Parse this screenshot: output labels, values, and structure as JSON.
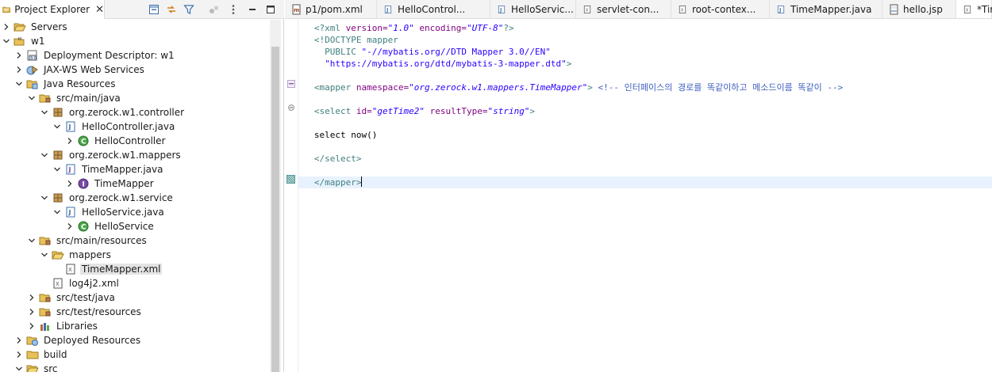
{
  "explorer": {
    "tab_title": "Project Explorer",
    "close_glyph": "✕",
    "toolbar_icons": [
      "collapse-all-icon",
      "link-with-editor-icon",
      "filter-icon",
      "focus-icon",
      "view-menu-icon",
      "minimize-icon",
      "maximize-icon"
    ],
    "tree": [
      {
        "label": "Servers",
        "icon": "folder-open-icon",
        "depth": 0,
        "twisty": "collapsed"
      },
      {
        "label": "w1",
        "icon": "web-project-icon",
        "depth": 0,
        "twisty": "expanded"
      },
      {
        "label": "Deployment Descriptor: w1",
        "icon": "deployment-descriptor-icon",
        "depth": 1,
        "twisty": "collapsed"
      },
      {
        "label": "JAX-WS Web Services",
        "icon": "web-services-icon",
        "depth": 1,
        "twisty": "collapsed"
      },
      {
        "label": "Java Resources",
        "icon": "java-resources-icon",
        "depth": 1,
        "twisty": "expanded"
      },
      {
        "label": "src/main/java",
        "icon": "source-folder-icon",
        "depth": 2,
        "twisty": "expanded"
      },
      {
        "label": "org.zerock.w1.controller",
        "icon": "package-icon",
        "depth": 3,
        "twisty": "expanded"
      },
      {
        "label": "HelloController.java",
        "icon": "java-file-icon",
        "depth": 4,
        "twisty": "expanded"
      },
      {
        "label": "HelloController",
        "icon": "class-icon",
        "depth": 5,
        "twisty": "collapsed"
      },
      {
        "label": "org.zerock.w1.mappers",
        "icon": "package-icon",
        "depth": 3,
        "twisty": "expanded"
      },
      {
        "label": "TimeMapper.java",
        "icon": "java-interface-file-icon",
        "depth": 4,
        "twisty": "expanded"
      },
      {
        "label": "TimeMapper",
        "icon": "interface-icon",
        "depth": 5,
        "twisty": "collapsed"
      },
      {
        "label": "org.zerock.w1.service",
        "icon": "package-icon",
        "depth": 3,
        "twisty": "expanded"
      },
      {
        "label": "HelloService.java",
        "icon": "java-file-icon",
        "depth": 4,
        "twisty": "expanded"
      },
      {
        "label": "HelloService",
        "icon": "class-icon",
        "depth": 5,
        "twisty": "collapsed"
      },
      {
        "label": "src/main/resources",
        "icon": "source-folder-icon",
        "depth": 2,
        "twisty": "expanded"
      },
      {
        "label": "mappers",
        "icon": "folder-open-icon",
        "depth": 3,
        "twisty": "expanded"
      },
      {
        "label": "TimeMapper.xml",
        "icon": "xml-file-icon",
        "depth": 4,
        "twisty": "none",
        "selected": true
      },
      {
        "label": "log4j2.xml",
        "icon": "xml-file-icon",
        "depth": 3,
        "twisty": "none"
      },
      {
        "label": "src/test/java",
        "icon": "source-folder-icon",
        "depth": 2,
        "twisty": "collapsed"
      },
      {
        "label": "src/test/resources",
        "icon": "source-folder-icon",
        "depth": 2,
        "twisty": "collapsed"
      },
      {
        "label": "Libraries",
        "icon": "libraries-icon",
        "depth": 2,
        "twisty": "collapsed"
      },
      {
        "label": "Deployed Resources",
        "icon": "deployed-resources-icon",
        "depth": 1,
        "twisty": "collapsed"
      },
      {
        "label": "build",
        "icon": "folder-icon",
        "depth": 1,
        "twisty": "collapsed"
      },
      {
        "label": "src",
        "icon": "folder-open-icon",
        "depth": 1,
        "twisty": "expanded"
      }
    ]
  },
  "editor": {
    "tabs": [
      {
        "label": "p1/pom.xml",
        "icon": "maven-pom-icon"
      },
      {
        "label": "HelloControl...",
        "icon": "java-file-icon"
      },
      {
        "label": "HelloServic...",
        "icon": "java-file-icon"
      },
      {
        "label": "servlet-con...",
        "icon": "xml-file-icon"
      },
      {
        "label": "root-contex...",
        "icon": "xml-file-icon"
      },
      {
        "label": "TimeMapper.java",
        "icon": "java-file-icon"
      },
      {
        "label": "hello.jsp",
        "icon": "jsp-file-icon"
      },
      {
        "label": "*Tir",
        "icon": "xml-file-icon",
        "active": true
      }
    ],
    "lines": [
      {
        "tokens": [
          [
            "t-tag",
            "<?xml "
          ],
          [
            "t-attr",
            "version="
          ],
          [
            "t-val",
            "\"1.0\""
          ],
          [
            "t-attr",
            " encoding="
          ],
          [
            "t-val",
            "\"UTF-8\""
          ],
          [
            "t-tag",
            "?>"
          ]
        ]
      },
      {
        "tokens": [
          [
            "t-doc",
            "<!DOCTYPE mapper"
          ]
        ]
      },
      {
        "tokens": [
          [
            "t-doc",
            "  PUBLIC "
          ],
          [
            "t-str",
            "\"-//mybatis.org//DTD Mapper 3.0//EN\""
          ]
        ]
      },
      {
        "tokens": [
          [
            "t-str",
            "  \"https://mybatis.org/dtd/mybatis-3-mapper.dtd\""
          ],
          [
            "t-doc",
            ">"
          ]
        ]
      },
      {
        "tokens": []
      },
      {
        "tokens": [
          [
            "t-tag",
            "<mapper "
          ],
          [
            "t-attr",
            "namespace="
          ],
          [
            "t-val",
            "\"org.zerock.w1.mappers.TimeMapper\""
          ],
          [
            "t-tag",
            ">"
          ],
          [
            "t-cmt",
            " <!-- 인터페이스의 경로를 똑같이하고 메소드이름 똑같이 -->"
          ]
        ]
      },
      {
        "tokens": []
      },
      {
        "tokens": [
          [
            "t-tag",
            "<select "
          ],
          [
            "t-attr",
            "id="
          ],
          [
            "t-val",
            "\"getTime2\""
          ],
          [
            "t-attr",
            " resultType="
          ],
          [
            "t-val",
            "\"string\""
          ],
          [
            "t-tag",
            ">"
          ]
        ]
      },
      {
        "tokens": []
      },
      {
        "tokens": [
          [
            "t-txt",
            "select now()"
          ]
        ]
      },
      {
        "tokens": []
      },
      {
        "tokens": [
          [
            "t-tag",
            "</select>"
          ]
        ]
      },
      {
        "tokens": []
      },
      {
        "tokens": [
          [
            "t-tag",
            "</mapper>"
          ]
        ],
        "current": true,
        "caret": true
      }
    ]
  }
}
